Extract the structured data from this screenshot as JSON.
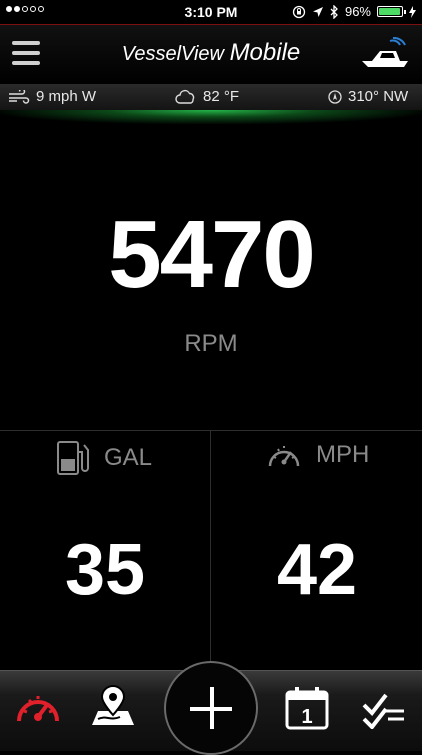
{
  "status_bar": {
    "time": "3:10 PM",
    "battery": "96%",
    "battery_level": 0.96,
    "signal_dots_filled": 2,
    "signal_dots_total": 5
  },
  "header": {
    "title_plain": "VesselView",
    "title_emph": "Mobile"
  },
  "conditions": {
    "wind": "9  mph  W",
    "temperature": "82  °F",
    "heading": "310° NW"
  },
  "rpm": {
    "value": "5470",
    "label": "RPM"
  },
  "fuel": {
    "label": "GAL",
    "value": "35"
  },
  "speed": {
    "label": "MPH",
    "value": "42"
  },
  "colors": {
    "accent_red": "#e0202a",
    "glow_green": "#28c850",
    "battery_green": "#4cd964"
  },
  "icons": {
    "tab1": "gauge-icon",
    "tab2": "map-pin-icon",
    "tab3": "add-icon",
    "tab4": "calendar-icon",
    "tab5": "checklist-icon"
  },
  "calendar_day": "1"
}
